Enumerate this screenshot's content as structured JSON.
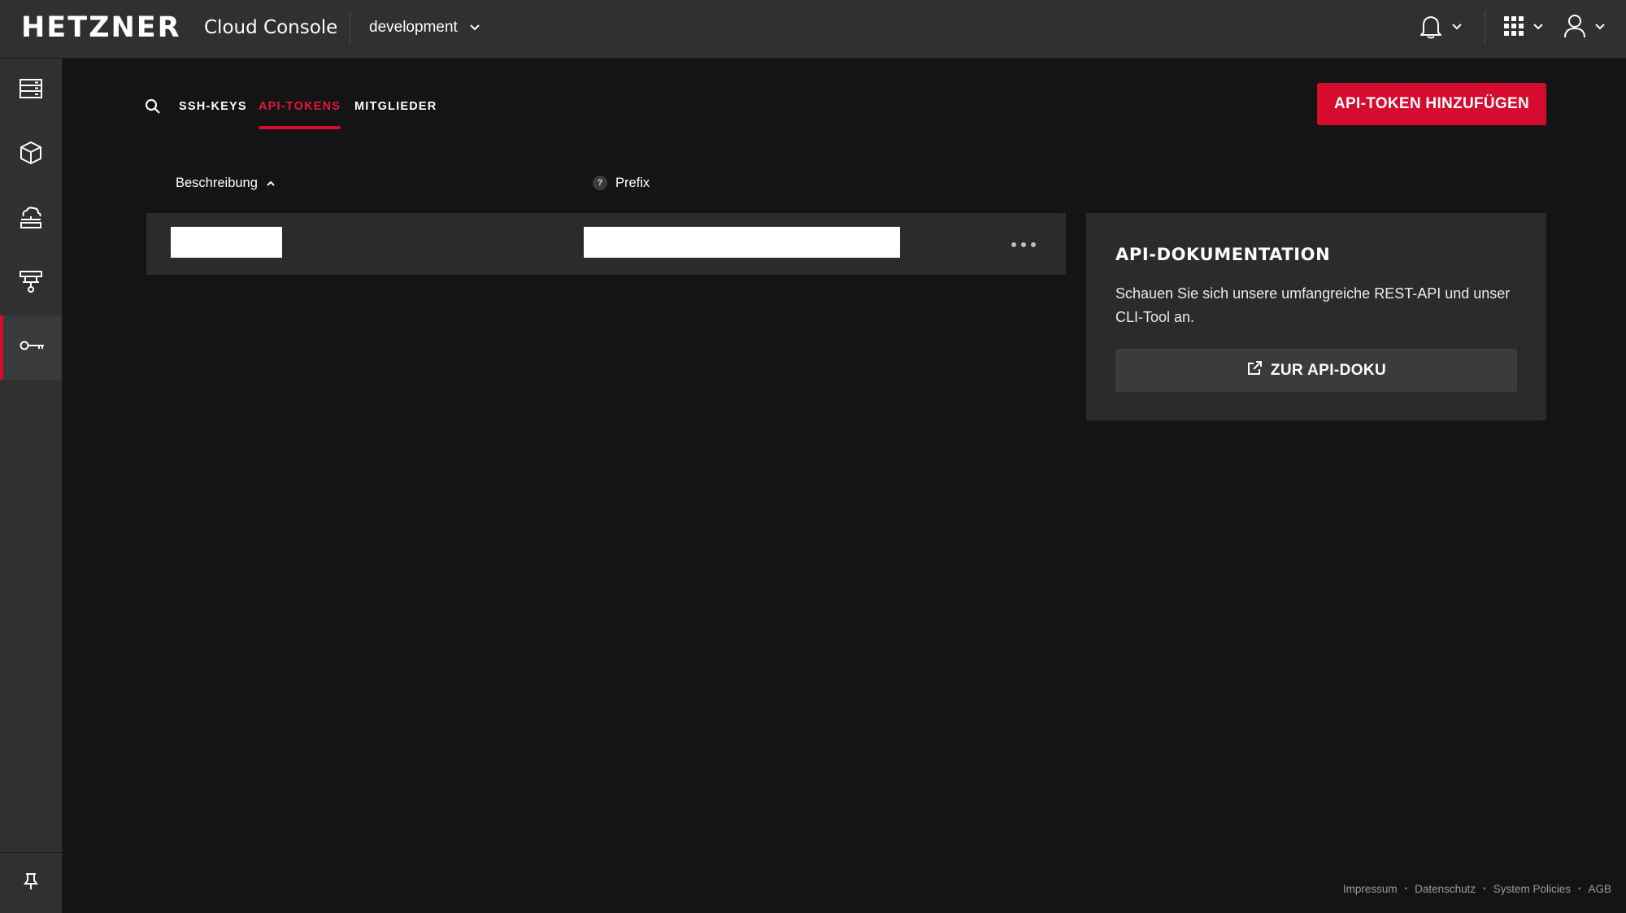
{
  "header": {
    "brand": "HETZNER",
    "console_title": "Cloud Console",
    "project": "development"
  },
  "sidebar": {
    "items": [
      {
        "name": "servers",
        "icon": "server-icon"
      },
      {
        "name": "volumes",
        "icon": "box-icon"
      },
      {
        "name": "networks",
        "icon": "cloud-network-icon"
      },
      {
        "name": "load-balancers",
        "icon": "load-balancer-icon"
      },
      {
        "name": "security",
        "icon": "key-icon",
        "active": true
      }
    ],
    "pin_icon": "pin-icon"
  },
  "tabs": [
    {
      "label": "SSH-KEYS",
      "active": false
    },
    {
      "label": "API-TOKENS",
      "active": true
    },
    {
      "label": "MITGLIEDER",
      "active": false
    }
  ],
  "add_button_label": "API-TOKEN HINZUFÜGEN",
  "table": {
    "columns": {
      "description": "Beschreibung",
      "prefix_help": "?",
      "prefix": "Prefix"
    },
    "rows": [
      {
        "description": "",
        "prefix": ""
      }
    ]
  },
  "docs": {
    "title": "API-DOKUMENTATION",
    "text": "Schauen Sie sich unsere umfangreiche REST-API und unser CLI-Tool an.",
    "button_label": "ZUR API-DOKU"
  },
  "footer": {
    "links": [
      "Impressum",
      "Datenschutz",
      "System Policies",
      "AGB"
    ],
    "separator": "•"
  },
  "colors": {
    "accent": "#d50c2d",
    "background": "#141414",
    "panel": "#303030",
    "row": "#2b2b2b"
  }
}
